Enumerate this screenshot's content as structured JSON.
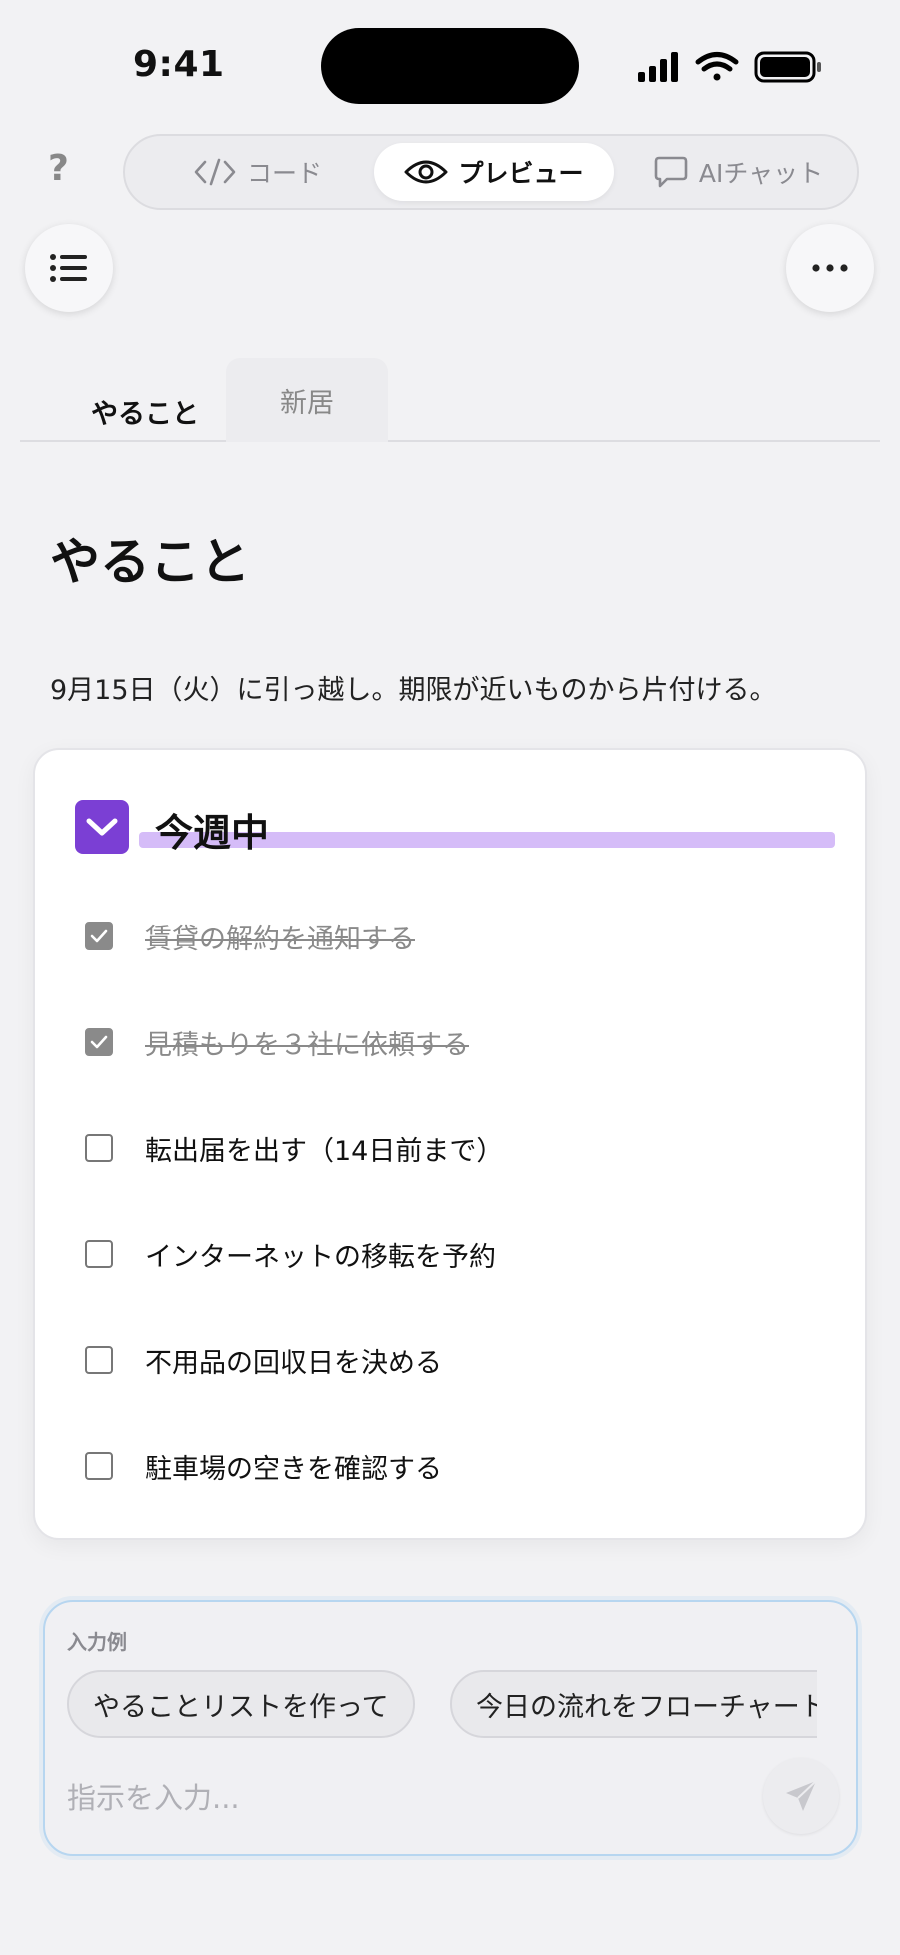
{
  "status_bar": {
    "time": "9:41",
    "icons": [
      "cellular-signal-icon",
      "wifi-icon",
      "battery-icon"
    ]
  },
  "toolbar": {
    "help": "?",
    "segments": [
      {
        "label": "コード",
        "icon": "code-icon"
      },
      {
        "label": "プレビュー",
        "icon": "eye-icon",
        "active": true
      },
      {
        "label": "AIチャット",
        "icon": "chat-bubble-icon"
      }
    ],
    "menu_icon": "list-icon",
    "more_icon": "ellipsis-icon"
  },
  "doc_tabs": [
    {
      "label": "やること",
      "active": true
    },
    {
      "label": "新居",
      "active": false
    }
  ],
  "page": {
    "title": "やること",
    "intro": "9月15日（火）に引っ越し。期限が近いものから片付ける。"
  },
  "section": {
    "title": "今週中",
    "accent_color": "#7b3fd4",
    "highlight_color": "#d5bcf8",
    "tasks": [
      {
        "label": "賃貸の解約を通知する",
        "done": true
      },
      {
        "label": "見積もりを３社に依頼する",
        "done": true
      },
      {
        "label": "転出届を出す（14日前まで）",
        "done": false
      },
      {
        "label": "インターネットの移転を予約",
        "done": false
      },
      {
        "label": "不用品の回収日を決める",
        "done": false
      },
      {
        "label": "駐車場の空きを確認する",
        "done": false
      }
    ]
  },
  "composer": {
    "label": "入力例",
    "chips": [
      "やることリストを作って",
      "今日の流れをフローチャート"
    ],
    "placeholder": "指示を入力...",
    "value": "",
    "send_icon": "paper-plane-icon",
    "border_color": "#b7d6f0"
  }
}
